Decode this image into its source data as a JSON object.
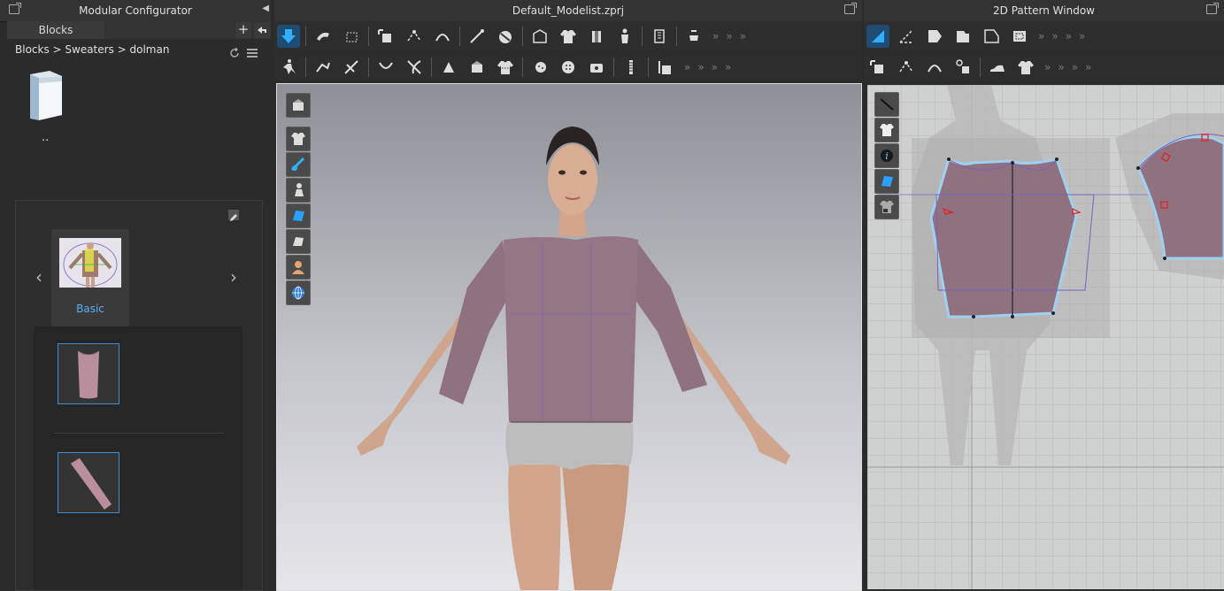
{
  "left_panel": {
    "title": "Modular Configurator",
    "tab_label": "Blocks",
    "breadcrumb": "Blocks > Sweaters > dolman",
    "folder_label": "..",
    "category": {
      "label": "Basic",
      "prev_icon": "chevron-left-icon",
      "next_icon": "chevron-right-icon"
    },
    "blocks": [
      {
        "name": "bodice-block",
        "icon": "bodice-thumbnail"
      },
      {
        "name": "sleeve-block",
        "icon": "sleeve-thumbnail"
      }
    ]
  },
  "center_panel": {
    "title": "Default_Modelist.zprj"
  },
  "right_panel": {
    "title": "2D Pattern Window"
  },
  "colors": {
    "panel_bg": "#2b2b2b",
    "accent": "#3f8fd0",
    "garment": "#8c6f7c",
    "viewport_top": "#8f9097",
    "viewport_bottom": "#e6e6ea",
    "pattern_grid": "#cfd0d0"
  }
}
